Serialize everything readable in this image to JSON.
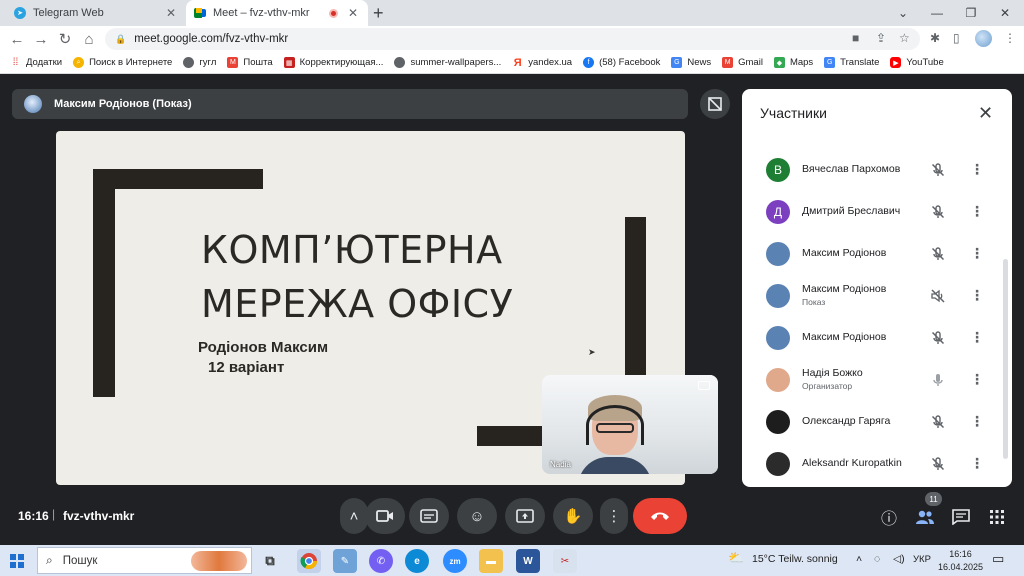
{
  "browser": {
    "tabs": [
      {
        "title": "Telegram Web",
        "icon": "telegram-icon",
        "active": false
      },
      {
        "title": "Meet – fvz-vthv-mkr",
        "icon": "google-meet-icon",
        "active": true
      }
    ],
    "url": "meet.google.com/fvz-vthv-mkr",
    "bookmarks": [
      {
        "label": "Додатки",
        "icon": "apps-grid-icon"
      },
      {
        "label": "Поиск в Интернете",
        "icon": "search-globe-icon"
      },
      {
        "label": "гугл",
        "icon": "globe-icon"
      },
      {
        "label": "Пошта",
        "icon": "gmail-icon"
      },
      {
        "label": "Корректирующая...",
        "icon": "clapper-icon"
      },
      {
        "label": "summer-wallpapers...",
        "icon": "globe-icon"
      },
      {
        "label": "yandex.ua",
        "icon": "yandex-icon"
      },
      {
        "label": "(58) Facebook",
        "icon": "facebook-icon"
      },
      {
        "label": "News",
        "icon": "news-icon"
      },
      {
        "label": "Gmail",
        "icon": "gmail-icon"
      },
      {
        "label": "Maps",
        "icon": "maps-icon"
      },
      {
        "label": "Translate",
        "icon": "translate-icon"
      },
      {
        "label": "YouTube",
        "icon": "youtube-icon"
      }
    ]
  },
  "meet": {
    "presenter_label": "Максим Родіонов (Показ)",
    "slide": {
      "title_line1": "КОМП’ЮТЕРНА",
      "title_line2": "МЕРЕЖА ОФІСУ",
      "author": "Родіонов Максим",
      "variant": "12 варіант"
    },
    "self_view_name": "Nadia",
    "panel": {
      "title": "Участники",
      "participants": [
        {
          "initial": "В",
          "name": "Вячеслав Пархомов",
          "sub": "",
          "avatar_color": "#1e7e34",
          "mic": "muted"
        },
        {
          "initial": "Д",
          "name": "Дмитрий Бреславич",
          "sub": "",
          "avatar_color": "#7b3fbf",
          "mic": "muted"
        },
        {
          "initial": "",
          "name": "Максим Родіонов",
          "sub": "",
          "avatar_color": "#5a82b3",
          "mic": "muted"
        },
        {
          "initial": "",
          "name": "Максим Родіонов",
          "sub": "Показ",
          "avatar_color": "#5a82b3",
          "mic": "volume-off"
        },
        {
          "initial": "",
          "name": "Максим Родіонов",
          "sub": "",
          "avatar_color": "#5a82b3",
          "mic": "muted"
        },
        {
          "initial": "",
          "name": "Надія Божко",
          "sub": "Организатор",
          "avatar_color": "#e0a98c",
          "mic": "on"
        },
        {
          "initial": "",
          "name": "Олександр Гаряга",
          "sub": "",
          "avatar_color": "#1d1d1d",
          "mic": "muted"
        },
        {
          "initial": "",
          "name": "Aleksandr Kuropatkin",
          "sub": "",
          "avatar_color": "#2b2b2b",
          "mic": "muted"
        }
      ]
    },
    "bottom": {
      "time": "16:16",
      "separator": "|",
      "meeting_code": "fvz-vthv-mkr",
      "participant_count": "11"
    }
  },
  "taskbar": {
    "search_placeholder": "Пошук",
    "weather": "15°C  Teilw. sonnig",
    "language": "УКР",
    "time": "16:16",
    "date": "16.04.2025"
  },
  "colors": {
    "meet_bg": "#202124",
    "end_call": "#ea4335",
    "slide_bg": "#efede7"
  }
}
